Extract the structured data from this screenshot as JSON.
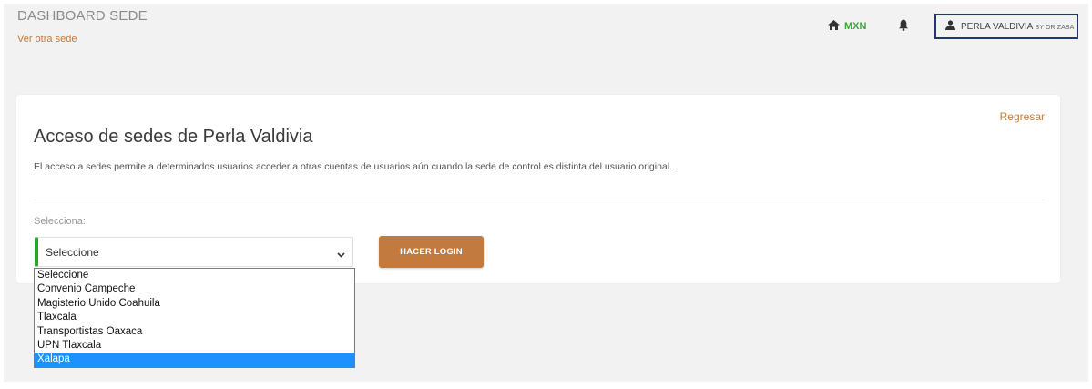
{
  "header": {
    "title": "DASHBOARD SEDE",
    "other_site_link": "Ver otra sede",
    "currency": "MXN",
    "user_name": "PERLA VALDIVIA",
    "user_suffix": "BY ORIZABA"
  },
  "card": {
    "back_link": "Regresar",
    "title": "Acceso de sedes de Perla Valdivia",
    "description": "El acceso a sedes permite a determinados usuarios acceder a otras cuentas de usuarios aún cuando la sede de control es distinta del usuario original.",
    "select_label": "Selecciona:",
    "select_value": "Seleccione",
    "login_button": "HACER LOGIN"
  },
  "dropdown": {
    "options": [
      "Seleccione",
      "Convenio Campeche",
      "Magisterio Unido Coahuila",
      "Tlaxcala",
      "Transportistas Oaxaca",
      "UPN Tlaxcala",
      "Xalapa"
    ],
    "highlighted": "Xalapa"
  },
  "colors": {
    "accent": "#c27a3e",
    "link": "#c07a3a",
    "currency_green": "#3fa043",
    "select_border_green": "#27a92b",
    "user_box_border": "#22376b",
    "highlight": "#1e90ff"
  },
  "icons": [
    "home-icon",
    "bell-icon",
    "user-icon",
    "chevron-down-icon"
  ]
}
